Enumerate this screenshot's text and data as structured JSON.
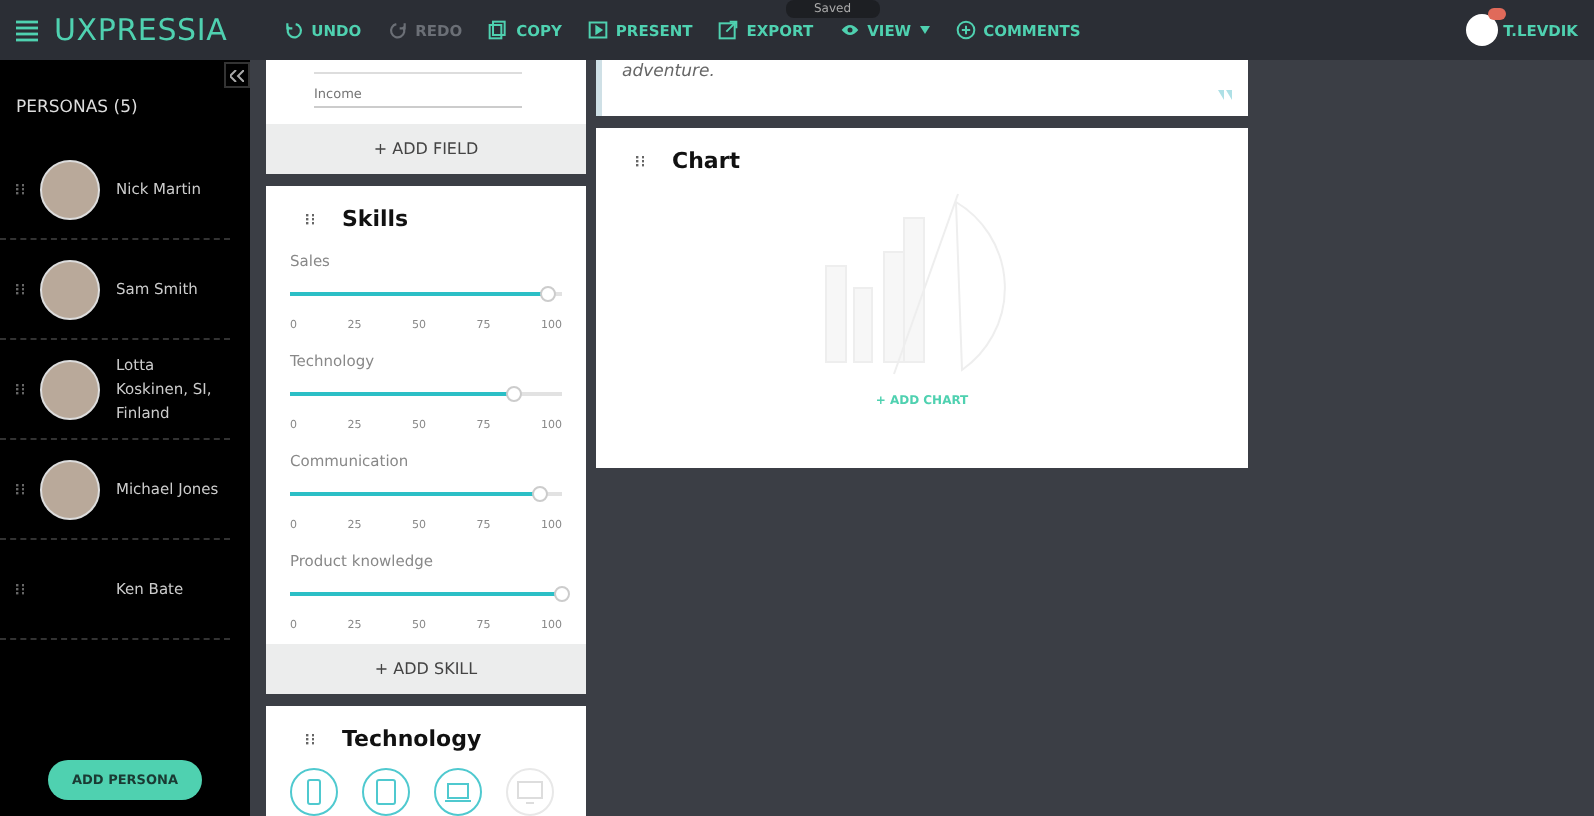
{
  "app": {
    "logo": "UXPRESSIA",
    "user": "T.LEVDIK",
    "tooltip": "Saved"
  },
  "toolbar": [
    {
      "label": "UNDO",
      "kind": "undo",
      "disabled": false
    },
    {
      "label": "REDO",
      "kind": "redo",
      "disabled": true
    },
    {
      "label": "COPY",
      "kind": "copy",
      "disabled": false
    },
    {
      "label": "PRESENT",
      "kind": "present",
      "disabled": false
    },
    {
      "label": "EXPORT",
      "kind": "export",
      "disabled": false
    },
    {
      "label": "VIEW",
      "kind": "view",
      "disabled": false
    },
    {
      "label": "COMMENTS",
      "kind": "comments",
      "disabled": false
    }
  ],
  "sidebar": {
    "title": "PERSONAS (5)",
    "button": "ADD PERSONA",
    "personas": [
      {
        "name": "Nick Martin",
        "photo": true
      },
      {
        "name": "Sam Smith",
        "photo": true
      },
      {
        "name": "Lotta Koskinen, SI, Finland",
        "photo": true
      },
      {
        "name": "Michael Jones",
        "photo": true
      },
      {
        "name": "Ken Bate",
        "photo": false
      }
    ]
  },
  "fields_card": {
    "field_placeholder": "Income",
    "button": "+ ADD FIELD"
  },
  "skills": {
    "title": "Skills",
    "button": "+ ADD SKILL",
    "items": [
      {
        "name": "Sales",
        "level": 0.95,
        "ticks": [
          "0",
          "25",
          "50",
          "75",
          "100"
        ]
      },
      {
        "name": "Technology",
        "level": 0.82,
        "ticks": [
          "0",
          "25",
          "50",
          "75",
          "100"
        ]
      },
      {
        "name": "Communication",
        "level": 0.92,
        "ticks": [
          "0",
          "25",
          "50",
          "75",
          "100"
        ]
      },
      {
        "name": "Product knowledge",
        "level": 1.0,
        "ticks": [
          "0",
          "25",
          "50",
          "75",
          "100"
        ]
      }
    ]
  },
  "technology": {
    "title": "Technology",
    "devices": [
      {
        "kind": "phone",
        "selected": true
      },
      {
        "kind": "tablet",
        "selected": true
      },
      {
        "kind": "laptop",
        "selected": true
      },
      {
        "kind": "desktop",
        "selected": false
      }
    ]
  },
  "quote": {
    "text": "adventure."
  },
  "chart": {
    "title": "Chart",
    "button": "+ ADD CHART"
  }
}
